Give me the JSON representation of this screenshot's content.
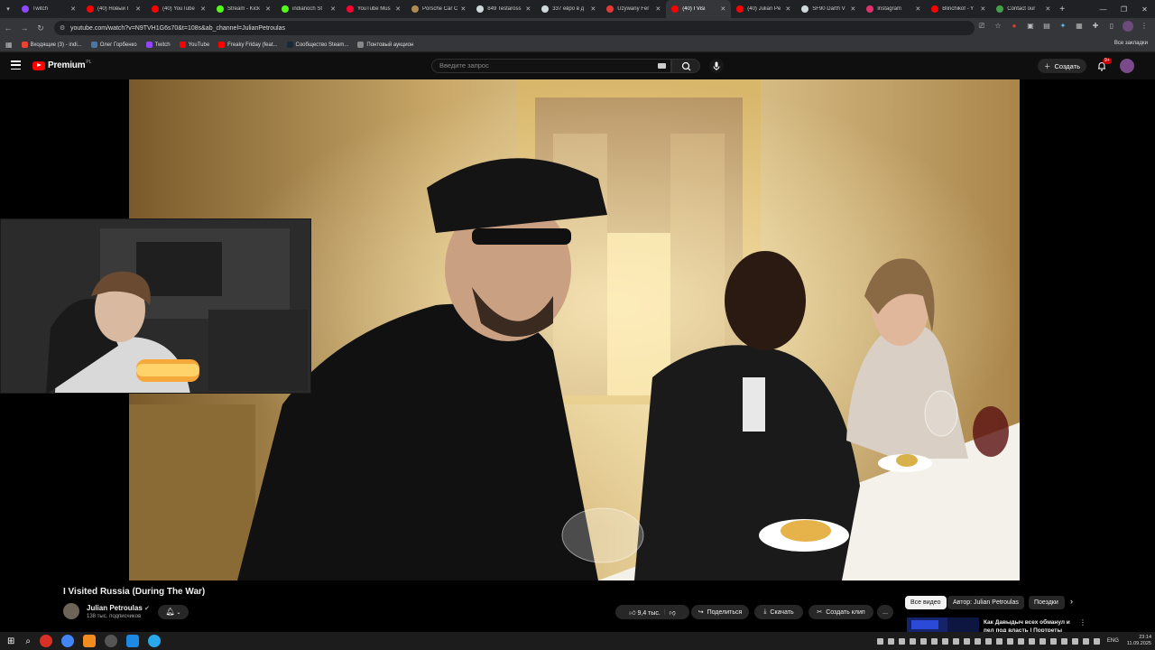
{
  "browser": {
    "tabs": [
      {
        "title": "Twitch",
        "color": "#9146ff"
      },
      {
        "title": "(40) Новый I",
        "color": "#ff0000"
      },
      {
        "title": "(40) YouTube",
        "color": "#ff0000"
      },
      {
        "title": "Stream - Kick",
        "color": "#53fc18"
      },
      {
        "title": "indianoch St",
        "color": "#53fc18"
      },
      {
        "title": "YouTube Mus",
        "color": "#ff0033"
      },
      {
        "title": "Porsche Car C",
        "color": "#b08a50"
      },
      {
        "title": "849 Testaross",
        "color": "#cfd8dc"
      },
      {
        "title": "337 евро в д",
        "color": "#cfd8dc"
      },
      {
        "title": "Używany Fer",
        "color": "#e53935"
      },
      {
        "title": "(40) I Visi",
        "color": "#ff0000",
        "active": true
      },
      {
        "title": "(40) Julian Pe",
        "color": "#ff0000"
      },
      {
        "title": "SF90 Darth V",
        "color": "#cfd8dc"
      },
      {
        "title": "Instagram",
        "color": "#e1306c"
      },
      {
        "title": "Blinchikof - Y",
        "color": "#ff0000"
      },
      {
        "title": "Contact our",
        "color": "#43a047"
      }
    ],
    "new_tab": "+",
    "url": "youtube.com/watch?v=N9TVH1G6s70&t=108s&ab_channel=JulianPetroulas",
    "bookmarks": [
      {
        "label": "Входящие (3) - indi...",
        "color": "#ea4335"
      },
      {
        "label": "Олег Горбенко",
        "color": "#4a76a8"
      },
      {
        "label": "Twitch",
        "color": "#9146ff"
      },
      {
        "label": "YouTube",
        "color": "#ff0000"
      },
      {
        "label": "Freaky Friday (feat...",
        "color": "#ff0000"
      },
      {
        "label": "Сообщество Steam...",
        "color": "#1b2838"
      },
      {
        "label": "Понтовый аукцион",
        "color": "#888888"
      }
    ],
    "all_bookmarks": "Все закладки"
  },
  "youtube": {
    "brand": "Premium",
    "brand_sup": "PL",
    "search_placeholder": "Введите запрос",
    "create_label": "Создать",
    "notif_badge": "9+",
    "video_title": "I Visited Russia (During The War)",
    "channel_name": "Julian Petroulas",
    "subscribers": "138 тыс. подписчиков",
    "likes": "9,4 тыс.",
    "share_label": "Поделиться",
    "download_label": "Скачать",
    "clip_label": "Создать клип",
    "more_label": "...",
    "chips": [
      "Все видео",
      "Автор: Julian Petroulas",
      "Поездки"
    ],
    "rec_title": "Как Давыдыч всех обманул и пел под власть | Портреты"
  },
  "taskbar": {
    "lang": "ENG",
    "time": "23:14",
    "date": "11.09.2025"
  }
}
